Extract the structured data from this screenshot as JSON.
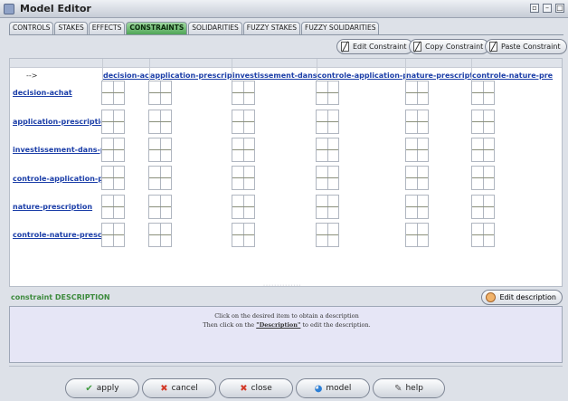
{
  "window": {
    "title": "Model Editor"
  },
  "tabs": [
    {
      "label": "CONTROLS"
    },
    {
      "label": "STAKES"
    },
    {
      "label": "EFFECTS"
    },
    {
      "label": "CONSTRAINTS",
      "active": true
    },
    {
      "label": "SOLIDARITIES"
    },
    {
      "label": "FUZZY STAKES"
    },
    {
      "label": "FUZZY SOLIDARITIES"
    }
  ],
  "toolbar": {
    "edit_constraint": "Edit Constraint",
    "copy_constraint": "Copy Constraint",
    "paste_constraint": "Paste Constraint"
  },
  "grid": {
    "corner_label": "-->",
    "columns": [
      "decision-achat",
      "application-prescription",
      "investissement-dans-pr",
      "controle-application-pre",
      "nature-prescription",
      "controle-nature-pre"
    ],
    "rows": [
      "decision-achat",
      "application-prescription",
      "investissement-dans-pr",
      "controle-application-pre",
      "nature-prescription",
      "controle-nature-presc"
    ],
    "dots": "::::::::::::::"
  },
  "description": {
    "label": "constraint DESCRIPTION",
    "edit_button": "Edit description",
    "line1": "Click on the desired item to obtain a description",
    "line2_prefix": "Then click on the ",
    "line2_link": "\"Description\"",
    "line2_suffix": " to edit the description."
  },
  "buttons": {
    "apply": "apply",
    "cancel": "cancel",
    "close": "close",
    "model": "model",
    "help": "help"
  }
}
